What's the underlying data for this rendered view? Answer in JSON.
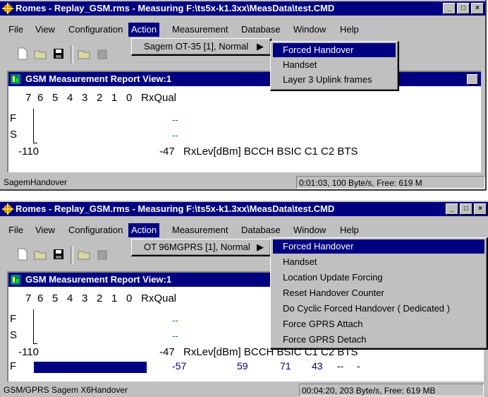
{
  "windows": [
    {
      "title": "Romes - Replay_GSM.rms - Measuring F:\\ts5x-k1.3xx\\MeasData\\test.CMD",
      "menu": [
        "File",
        "View",
        "Configuration",
        "Action",
        "Measurement",
        "Database",
        "Window",
        "Help"
      ],
      "child_title": "GSM Measurement Report View:1",
      "submenu_label": "Sagem OT-35 [1], Normal",
      "items": [
        "Forced Handover",
        "Handset",
        "Layer 3 Uplink frames"
      ],
      "scale_numbers": [
        "7",
        "6",
        "5",
        "4",
        "3",
        "2",
        "1",
        "0"
      ],
      "rxqual": "RxQual",
      "f_label": "F",
      "s_label": "S",
      "dash": "--",
      "left_val": "-110",
      "right_val": "-47",
      "columns": "RxLev[dBm] BCCH BSIC C1  C2  BTS",
      "status_left": "SagemHandover",
      "status_right": "0:01:03, 100 Byte/s, Free: 619 M"
    },
    {
      "title": "Romes - Replay_GSM.rms - Measuring F:\\ts5x-k1.3xx\\MeasData\\test.CMD",
      "menu": [
        "File",
        "View",
        "Configuration",
        "Action",
        "Measurement",
        "Database",
        "Window",
        "Help"
      ],
      "child_title": "GSM Measurement Report View:1",
      "submenu_label": "OT 96MGPRS [1], Normal",
      "items": [
        "Forced Handover",
        "Handset",
        "Location Update Forcing",
        "Reset Handover Counter",
        "Do Cyclic Forced Handover ( Dedicated )",
        "Force GPRS Attach",
        "Force GPRS Detach"
      ],
      "scale_numbers": [
        "7",
        "6",
        "5",
        "4",
        "3",
        "2",
        "1",
        "0"
      ],
      "rxqual": "RxQual",
      "f_label": "F",
      "s_label": "S",
      "dash": "--",
      "left_val": "-110",
      "right_val": "-47",
      "columns": "RxLev[dBm] BCCH BSIC C1  C2  BTS",
      "row_values": [
        "-57",
        "59",
        "71",
        "43",
        "--",
        "-"
      ],
      "row_f": "F",
      "status_left": "GSM/GPRS Sagem X6Handover",
      "status_right": "00:04:20, 203 Byte/s, Free: 619 MB"
    }
  ],
  "caption_buttons": [
    "_",
    "□",
    "×"
  ],
  "colors": {
    "titlebar": "#000080",
    "face": "#c0c0c0",
    "selection": "#000080",
    "dash": "#008000"
  }
}
